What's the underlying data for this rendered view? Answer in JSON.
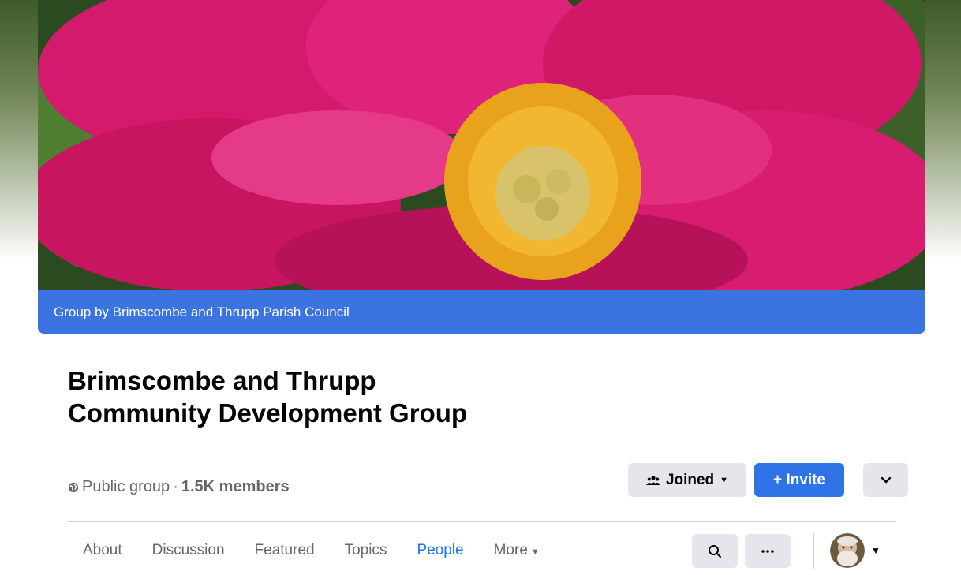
{
  "cover": {
    "banner_text": "Group by Brimscombe and Thrupp Parish Council",
    "photo_subject": "pink-peony-flower",
    "banner_color": "#3b74e0"
  },
  "group": {
    "name": "Brimscombe and Thrupp Community Development Group",
    "privacy": "Public group",
    "separator": "·",
    "members": "1.5K members"
  },
  "actions": {
    "joined_label": "Joined",
    "invite_label": "+ Invite"
  },
  "tabs": [
    {
      "label": "About",
      "active": false
    },
    {
      "label": "Discussion",
      "active": false
    },
    {
      "label": "Featured",
      "active": false
    },
    {
      "label": "Topics",
      "active": false
    },
    {
      "label": "People",
      "active": true
    },
    {
      "label": "More",
      "active": false
    }
  ],
  "colors": {
    "accent": "#1877f2",
    "button_blue": "#2f74e6",
    "button_grey": "#e4e6eb",
    "muted_text": "#65676b"
  },
  "icons": [
    "globe-icon",
    "group-people-icon",
    "caret-down-icon",
    "chevron-down-icon",
    "search-icon",
    "ellipsis-icon"
  ]
}
